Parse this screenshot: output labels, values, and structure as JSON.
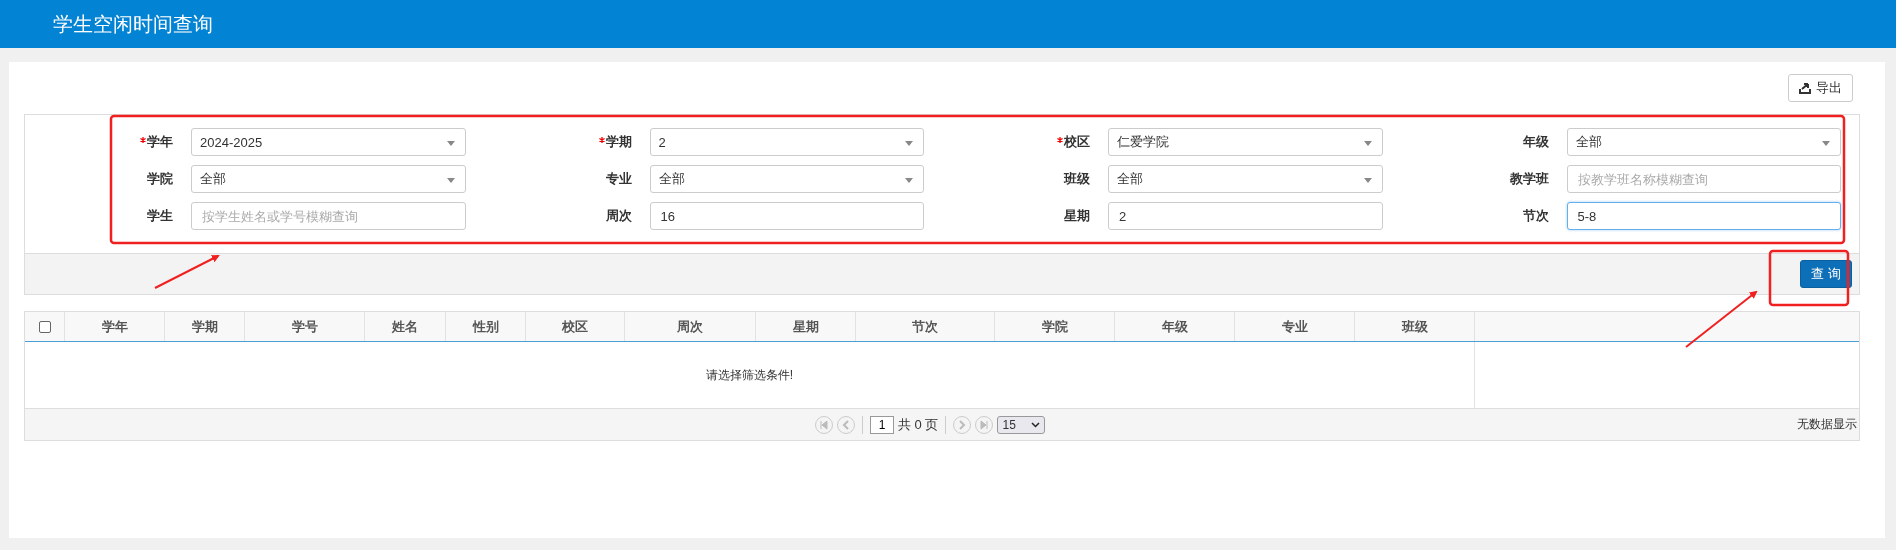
{
  "header": {
    "title": "学生空闲时间查询"
  },
  "toolbar": {
    "export_button": "导出"
  },
  "filters": [
    {
      "label": "学年",
      "required": true,
      "kind": "select",
      "value": "2024-2025",
      "focused": false
    },
    {
      "label": "学期",
      "required": true,
      "kind": "select",
      "value": "2",
      "focused": false
    },
    {
      "label": "校区",
      "required": true,
      "kind": "select",
      "value": "仁爱学院",
      "focused": false
    },
    {
      "label": "年级",
      "required": false,
      "kind": "select",
      "value": "全部",
      "focused": false
    },
    {
      "label": "学院",
      "required": false,
      "kind": "select",
      "value": "全部",
      "focused": false
    },
    {
      "label": "专业",
      "required": false,
      "kind": "select",
      "value": "全部",
      "focused": false
    },
    {
      "label": "班级",
      "required": false,
      "kind": "select",
      "value": "全部",
      "focused": false
    },
    {
      "label": "教学班",
      "required": false,
      "kind": "input",
      "placeholder": "按教学班名称模糊查询",
      "focused": false
    },
    {
      "label": "学生",
      "required": false,
      "kind": "input",
      "placeholder": "按学生姓名或学号模糊查询",
      "focused": false
    },
    {
      "label": "周次",
      "required": false,
      "kind": "input",
      "value": "16",
      "focused": false
    },
    {
      "label": "星期",
      "required": false,
      "kind": "input",
      "value": "2",
      "focused": false
    },
    {
      "label": "节次",
      "required": false,
      "kind": "input",
      "value": "5-8",
      "focused": true
    }
  ],
  "search_button": "查 询",
  "table": {
    "select_all_checked": false,
    "columns": [
      "学年",
      "学期",
      "学号",
      "姓名",
      "性别",
      "校区",
      "周次",
      "星期",
      "节次",
      "学院",
      "年级",
      "专业",
      "班级"
    ],
    "empty_message": "请选择筛选条件!"
  },
  "pager": {
    "page": "1",
    "total": "共 0 页",
    "page_size": "15",
    "status": "无数据显示"
  }
}
